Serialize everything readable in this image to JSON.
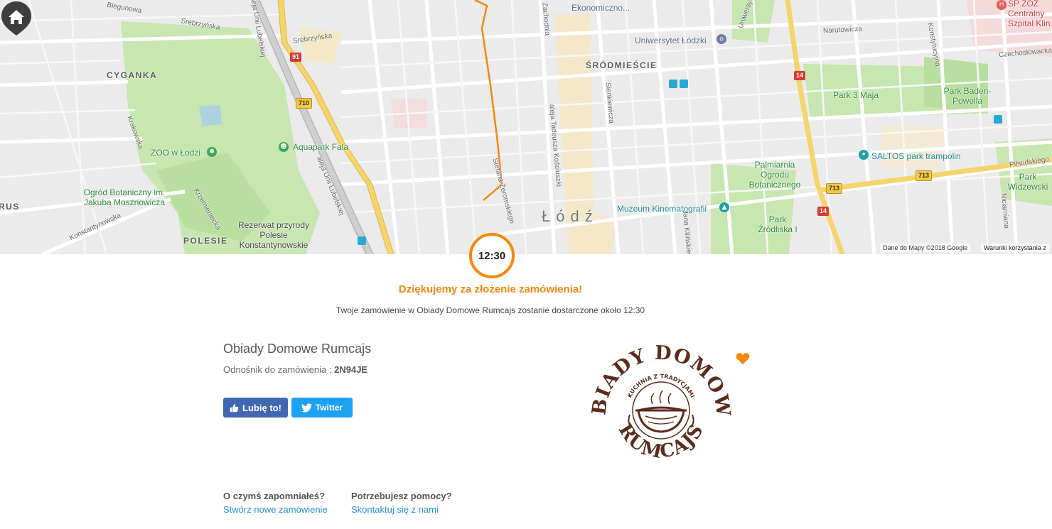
{
  "map": {
    "district_labels": [
      "CYGANKA",
      "ŚRÓDMIEŚCIE",
      "POLESIE",
      "RUS"
    ],
    "city_label": "Łódź",
    "green_labels": {
      "aquapark": "Aquapark Fala",
      "zoo": "ZOO w Łodzi",
      "botanic": "Ogród Botaniczny im. Jakuba Mosznowicza",
      "rezerwat": "Rezerwat przyrody Polesie Konstantynowskie",
      "park3maja": "Park 3 Maja",
      "parkbp": "Park Baden-Powella",
      "palmiarnia": "Palmiarnia Ogrodu Botanicznego",
      "zrodlisko": "Park Źródliska I",
      "widzewski": "Park Widzewski",
      "saltos": "SALTOS park trampolin",
      "muzeum": "Muzeum Kinematografii",
      "uniwersytet": "Uniwersytet Łódzki",
      "ekonom": "Ekonomiczno...",
      "szpital": "SP ZOZ Centralny Szpital Klin..."
    },
    "streets": {
      "biegunowa": "Biegunowa",
      "srebrzynska1": "Srebrzyńska",
      "srebrzynska2": "Srebrzyńska",
      "krakowska": "Krakowska",
      "krzemieniecka": "Krzemieniecka",
      "konstantynowska": "Konstantynowska",
      "unii": "aleja Unii Lubelskiej",
      "unii_top": "aleja Unii Lubelskiej",
      "zeromskiego": "Stefana Żeromskiego",
      "zachodnia": "Zachodnia",
      "kosciuszki": "aleja Tadeusza Kościuszki",
      "sienkiewicza": "Sienkiewicza",
      "kilinskiego": "Jana Kilińskiego",
      "narutowicza": "Narutowicza",
      "uniwersytecka": "Uniwersy...",
      "konstytucyjna": "Konstytucyjna",
      "czechoslowacka": "Czechosłowacka",
      "pilsudskiego": "Piłsudskiego",
      "niciarniana": "Niciarniana"
    },
    "road_numbers": {
      "r91": "91",
      "r710": "710",
      "r14a": "14",
      "r14b": "14",
      "r713a": "713",
      "r713b": "713"
    },
    "footer_data": "Dane do Mapy ©2018 Google",
    "footer_terms": "Warunki korzystania z"
  },
  "order": {
    "delivery_time": "12:30",
    "thanks": "Dziękujemy za złożenie zamówienia!",
    "eta_text": "Twoje zamówienie w Obiady Domowe Rumcajs zostanie dostarczone około 12:30",
    "restaurant_name": "Obiady Domowe Rumcajs",
    "ref_label": "Odnośnik do zamówienia :",
    "ref_code": "2N94JE"
  },
  "social": {
    "facebook_label": "Lubię to!",
    "twitter_label": "Twitter"
  },
  "logo": {
    "top_text": "OBIADY DOMOWE",
    "inner_text": "KUCHNIA Z TRADYCJAMI",
    "bottom_text": "RUMCAJS"
  },
  "help": {
    "col1_title": "O czymś zapomniałeś?",
    "col1_link": "Stwórz nowe zamówienie",
    "col2_title": "Potrzebujesz pomocy?",
    "col2_link": "Skontaktuj się z nami"
  },
  "colors": {
    "accent": "#f7870f",
    "facebook": "#4267b2",
    "twitter": "#1da1f2",
    "link": "#2a8fd6",
    "logo_brown": "#5a2d1a"
  }
}
